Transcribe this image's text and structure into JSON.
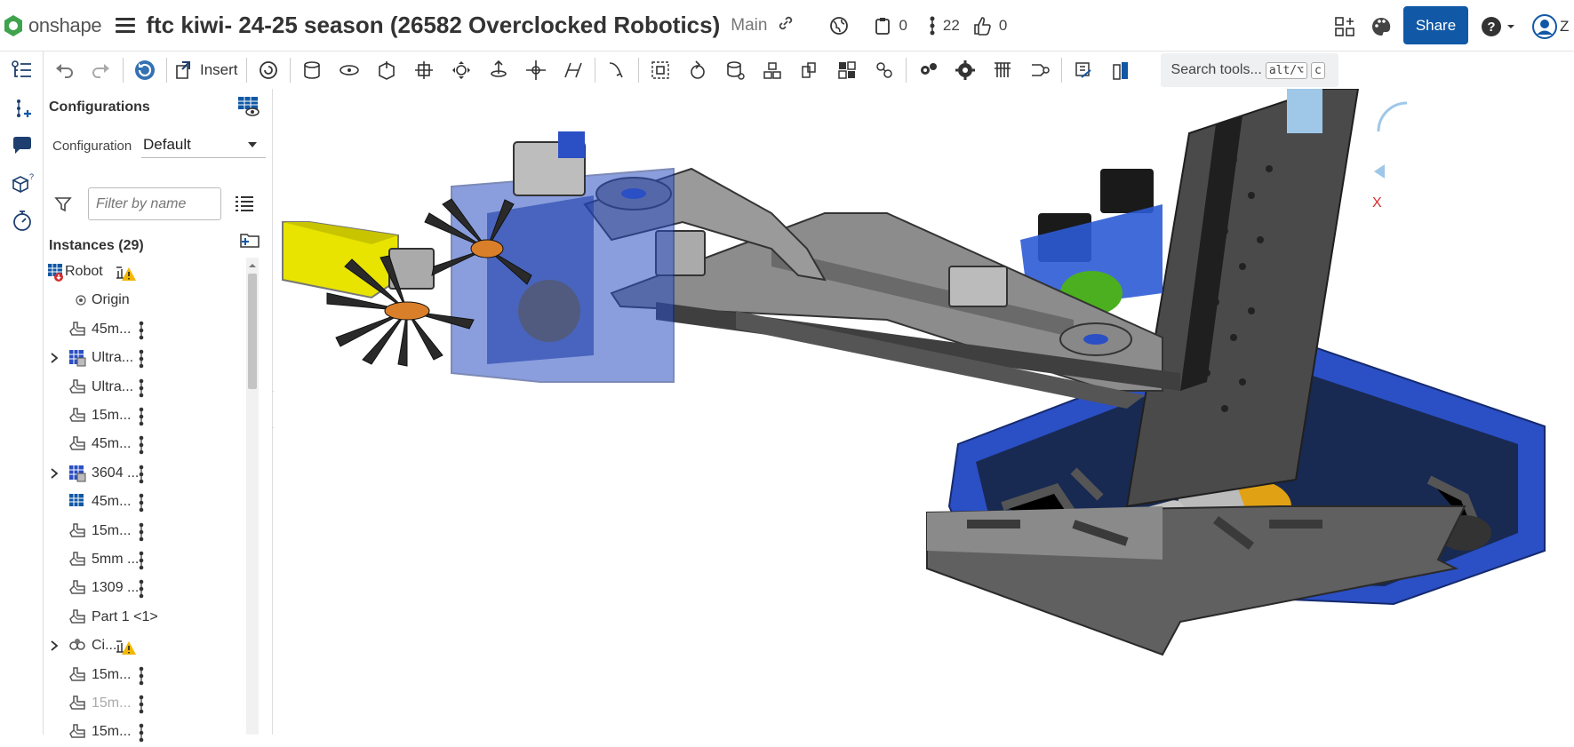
{
  "app": {
    "name": "onshape"
  },
  "document": {
    "title": "ftc kiwi- 24-25 season (26582 Overclocked Robotics)",
    "branch": "Main"
  },
  "topbar": {
    "copies_count": "0",
    "versions_count": "22",
    "likes_count": "0",
    "share_label": "Share",
    "user_initial": "Z"
  },
  "toolbar": {
    "insert_label": "Insert",
    "search_label": "Search tools...",
    "search_shortcut_1": "alt/⌥",
    "search_shortcut_2": "c"
  },
  "panel": {
    "title": "Configurations",
    "config_label": "Configuration",
    "config_value": "Default",
    "filter_placeholder": "Filter by name",
    "instances_label": "Instances (29)",
    "items": [
      {
        "label": "Robot",
        "icon": "assembly-icon",
        "warning": true,
        "expand": false,
        "kebab": false
      },
      {
        "label": "Origin",
        "icon": "origin-icon",
        "warning": false,
        "expand": false,
        "kebab": false
      },
      {
        "label": "45m...",
        "icon": "part-icon",
        "warning": false,
        "expand": false,
        "kebab": true
      },
      {
        "label": "Ultra...",
        "icon": "subassembly-icon",
        "warning": false,
        "expand": true,
        "kebab": true
      },
      {
        "label": "Ultra...",
        "icon": "part-icon",
        "warning": false,
        "expand": false,
        "kebab": true
      },
      {
        "label": "15m...",
        "icon": "part-icon",
        "warning": false,
        "expand": false,
        "kebab": true
      },
      {
        "label": "45m...",
        "icon": "part-icon",
        "warning": false,
        "expand": false,
        "kebab": true
      },
      {
        "label": "3604 ...",
        "icon": "subassembly-icon",
        "warning": false,
        "expand": true,
        "kebab": true
      },
      {
        "label": "45m...",
        "icon": "configured-part-icon",
        "warning": false,
        "expand": false,
        "kebab": true
      },
      {
        "label": "15m...",
        "icon": "part-icon",
        "warning": false,
        "expand": false,
        "kebab": true
      },
      {
        "label": "5mm ...",
        "icon": "part-icon",
        "warning": false,
        "expand": false,
        "kebab": true
      },
      {
        "label": "1309 ...",
        "icon": "part-icon",
        "warning": false,
        "expand": false,
        "kebab": true
      },
      {
        "label": "Part 1 <1>",
        "icon": "part-icon",
        "warning": false,
        "expand": false,
        "kebab": false
      },
      {
        "label": "Ci...",
        "icon": "pattern-icon",
        "warning": true,
        "expand": true,
        "kebab": false
      },
      {
        "label": "15m...",
        "icon": "part-icon",
        "warning": false,
        "expand": false,
        "kebab": true
      },
      {
        "label": "15m...",
        "icon": "part-icon",
        "warning": false,
        "expand": false,
        "kebab": true,
        "faded": true
      },
      {
        "label": "15m...",
        "icon": "part-icon",
        "warning": false,
        "expand": false,
        "kebab": true
      }
    ]
  },
  "viewport": {
    "triad_axis_label": "X"
  },
  "colors": {
    "accent": "#1158a6",
    "onshape_green": "#3fa34d",
    "warning": "#f2b705",
    "robot_blue": "#2a55c8"
  }
}
